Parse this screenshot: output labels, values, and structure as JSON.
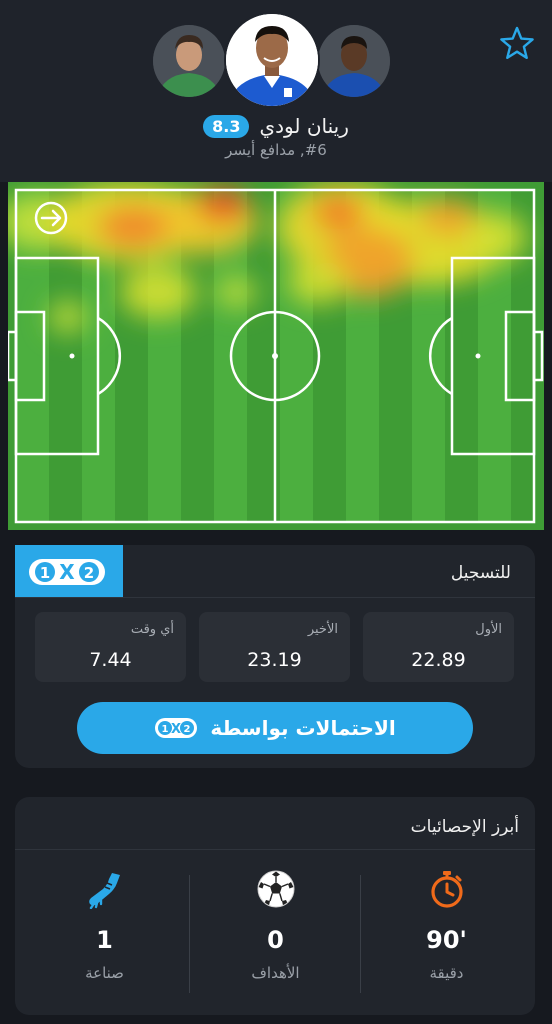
{
  "player": {
    "name": "رينان لودي",
    "rating": "8.3",
    "position": "#6, مدافع أيسر"
  },
  "colors": {
    "accent": "#2aa8e8",
    "card": "#21252c",
    "background": "#16191f",
    "pitch_light": "#4caf3f",
    "pitch_dark": "#3f9c35",
    "stopwatch": "#f06a1a"
  },
  "icons": {
    "favorite": "star-outline-icon",
    "direction": "arrow-right-icon",
    "minutes": "stopwatch-icon",
    "goals": "soccer-ball-icon",
    "assists": "boot-icon"
  },
  "odds": {
    "badge": {
      "left": "1",
      "center": "X",
      "right": "2"
    },
    "title": "للتسجيل",
    "boxes": [
      {
        "label": "الأول",
        "value": "22.89"
      },
      {
        "label": "الأخير",
        "value": "23.19"
      },
      {
        "label": "أي وقت",
        "value": "7.44"
      }
    ],
    "button_label": "الاحتمالات بواسطة"
  },
  "stats": {
    "title": "أبرز الإحصائيات",
    "items": [
      {
        "value": "90'",
        "label": "دقيقة"
      },
      {
        "value": "0",
        "label": "الأهداف"
      },
      {
        "value": "1",
        "label": "صناعة"
      }
    ]
  }
}
